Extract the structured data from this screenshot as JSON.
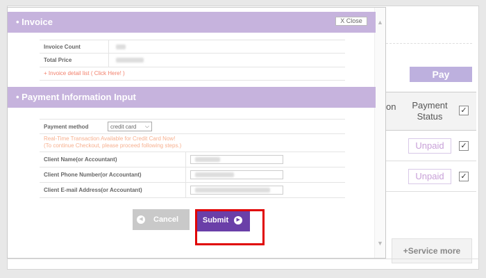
{
  "background": {
    "pay_label": "Pay",
    "column_partial": "on",
    "payment_status_header": "Payment Status",
    "rows": [
      {
        "status": "Unpaid",
        "checked": true
      },
      {
        "status": "Unpaid",
        "checked": true
      }
    ],
    "header_checked": true,
    "service_more": "+Service more"
  },
  "modal": {
    "invoice_title": "• Invoice",
    "close_label": "X Close",
    "invoice_count_label": "Invoice Count",
    "total_price_label": "Total Price",
    "invoice_link": "+ Invoice detail list ( Click Here! )",
    "payment_title": "• Payment Information Input",
    "payment_method_label": "Payment method",
    "payment_method_value": "credit card",
    "notice_line1": "Real-Time Transaction Available for Credit Card Now!",
    "notice_line2": "(To continue Checkout, please proceed following steps.)",
    "client_name_label": "Client Name(or Accountant)",
    "client_phone_label": "Client Phone Number(or Accountant)",
    "client_email_label": "Client E-mail Address(or Accountant)",
    "cancel_label": "Cancel",
    "submit_label": "Submit"
  },
  "colors": {
    "section_header": "#c6b3dd",
    "submit": "#6a3fa8",
    "highlight": "#e00000",
    "link": "#f2806c"
  },
  "icons": {
    "checkbox": "checkmark-icon",
    "button_arrow": "arrow-circle-icon",
    "select": "chevron-down-icon"
  }
}
